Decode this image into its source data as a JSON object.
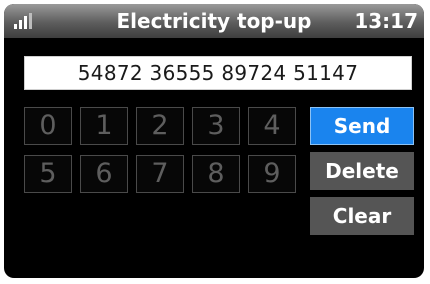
{
  "status_bar": {
    "title": "Electricity top-up",
    "time": "13:17",
    "signal_icon": "signal-strength-icon"
  },
  "code_input": {
    "value": "54872 36555 89724 51147"
  },
  "keypad": {
    "keys": [
      "0",
      "1",
      "2",
      "3",
      "4",
      "5",
      "6",
      "7",
      "8",
      "9"
    ]
  },
  "actions": {
    "send_label": "Send",
    "delete_label": "Delete",
    "clear_label": "Clear"
  },
  "colors": {
    "accent": "#1a84ee",
    "button_gray": "#555555",
    "screen_bg": "#000000"
  }
}
